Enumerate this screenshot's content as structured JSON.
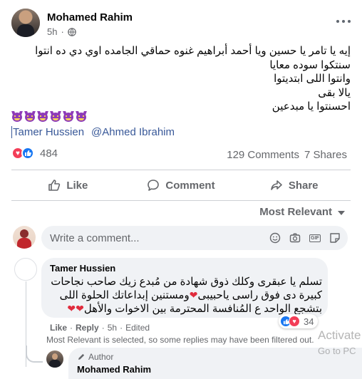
{
  "post": {
    "author": "Mohamed Rahim",
    "time": "5h",
    "privacy_dot": "·",
    "icons": {
      "privacy": "globe-icon",
      "more": "more-options-icon"
    },
    "text_lines": [
      "إيه يا  تامر يا حسين ويا أحمد أبراهيم غنوه حماقي الجامده اوي دي ده انتوا",
      "سنتكوا سوده معايا",
      "وانتوا اللى ابتديتوا",
      "يالا بقى",
      "احسنتوا يا مبدعين"
    ],
    "emoji_count": 6,
    "emoji_name": "smiling-devil-emoji",
    "tags": [
      "Tamer Hussien",
      "@Ahmed Ibrahim"
    ]
  },
  "reactions": {
    "types": [
      "love",
      "like"
    ],
    "count": "484",
    "comments": "129 Comments",
    "shares": "7 Shares"
  },
  "actions": [
    {
      "label": "Like",
      "icon": "thumbs-up-icon"
    },
    {
      "label": "Comment",
      "icon": "comment-bubble-icon"
    },
    {
      "label": "Share",
      "icon": "share-arrow-icon"
    }
  ],
  "sort": {
    "label": "Most Relevant"
  },
  "composer": {
    "placeholder": "Write a comment...",
    "tools": [
      "smiley-icon",
      "camera-icon",
      "gif-icon",
      "sticker-icon"
    ],
    "gif_label": "GIF"
  },
  "comment": {
    "author": "Tamer Hussien",
    "lines": [
      "تسلم يا عبقرى وكلك ذوق شهادة من مُبدع زيك صاحب نجاحات",
      "كبيرة دى فوق راسى ياحبيبى",
      "ومستنين إبداعاتك الحلوة اللى",
      "بتشجع الواحد ع المُنافسة المحترمة بين الاخوات والأهل"
    ],
    "reaction_count": "34",
    "like_label": "Like",
    "reply_label": "Reply",
    "time": "5h",
    "edited_label": "Edited",
    "separator": "·"
  },
  "filter_note": "Most Relevant is selected, so some replies may have been filtered out.",
  "reply": {
    "badge": "Author",
    "author": "Mohamed Rahim"
  },
  "watermark": {
    "line1": "Activate",
    "line2": "Go to PC"
  }
}
